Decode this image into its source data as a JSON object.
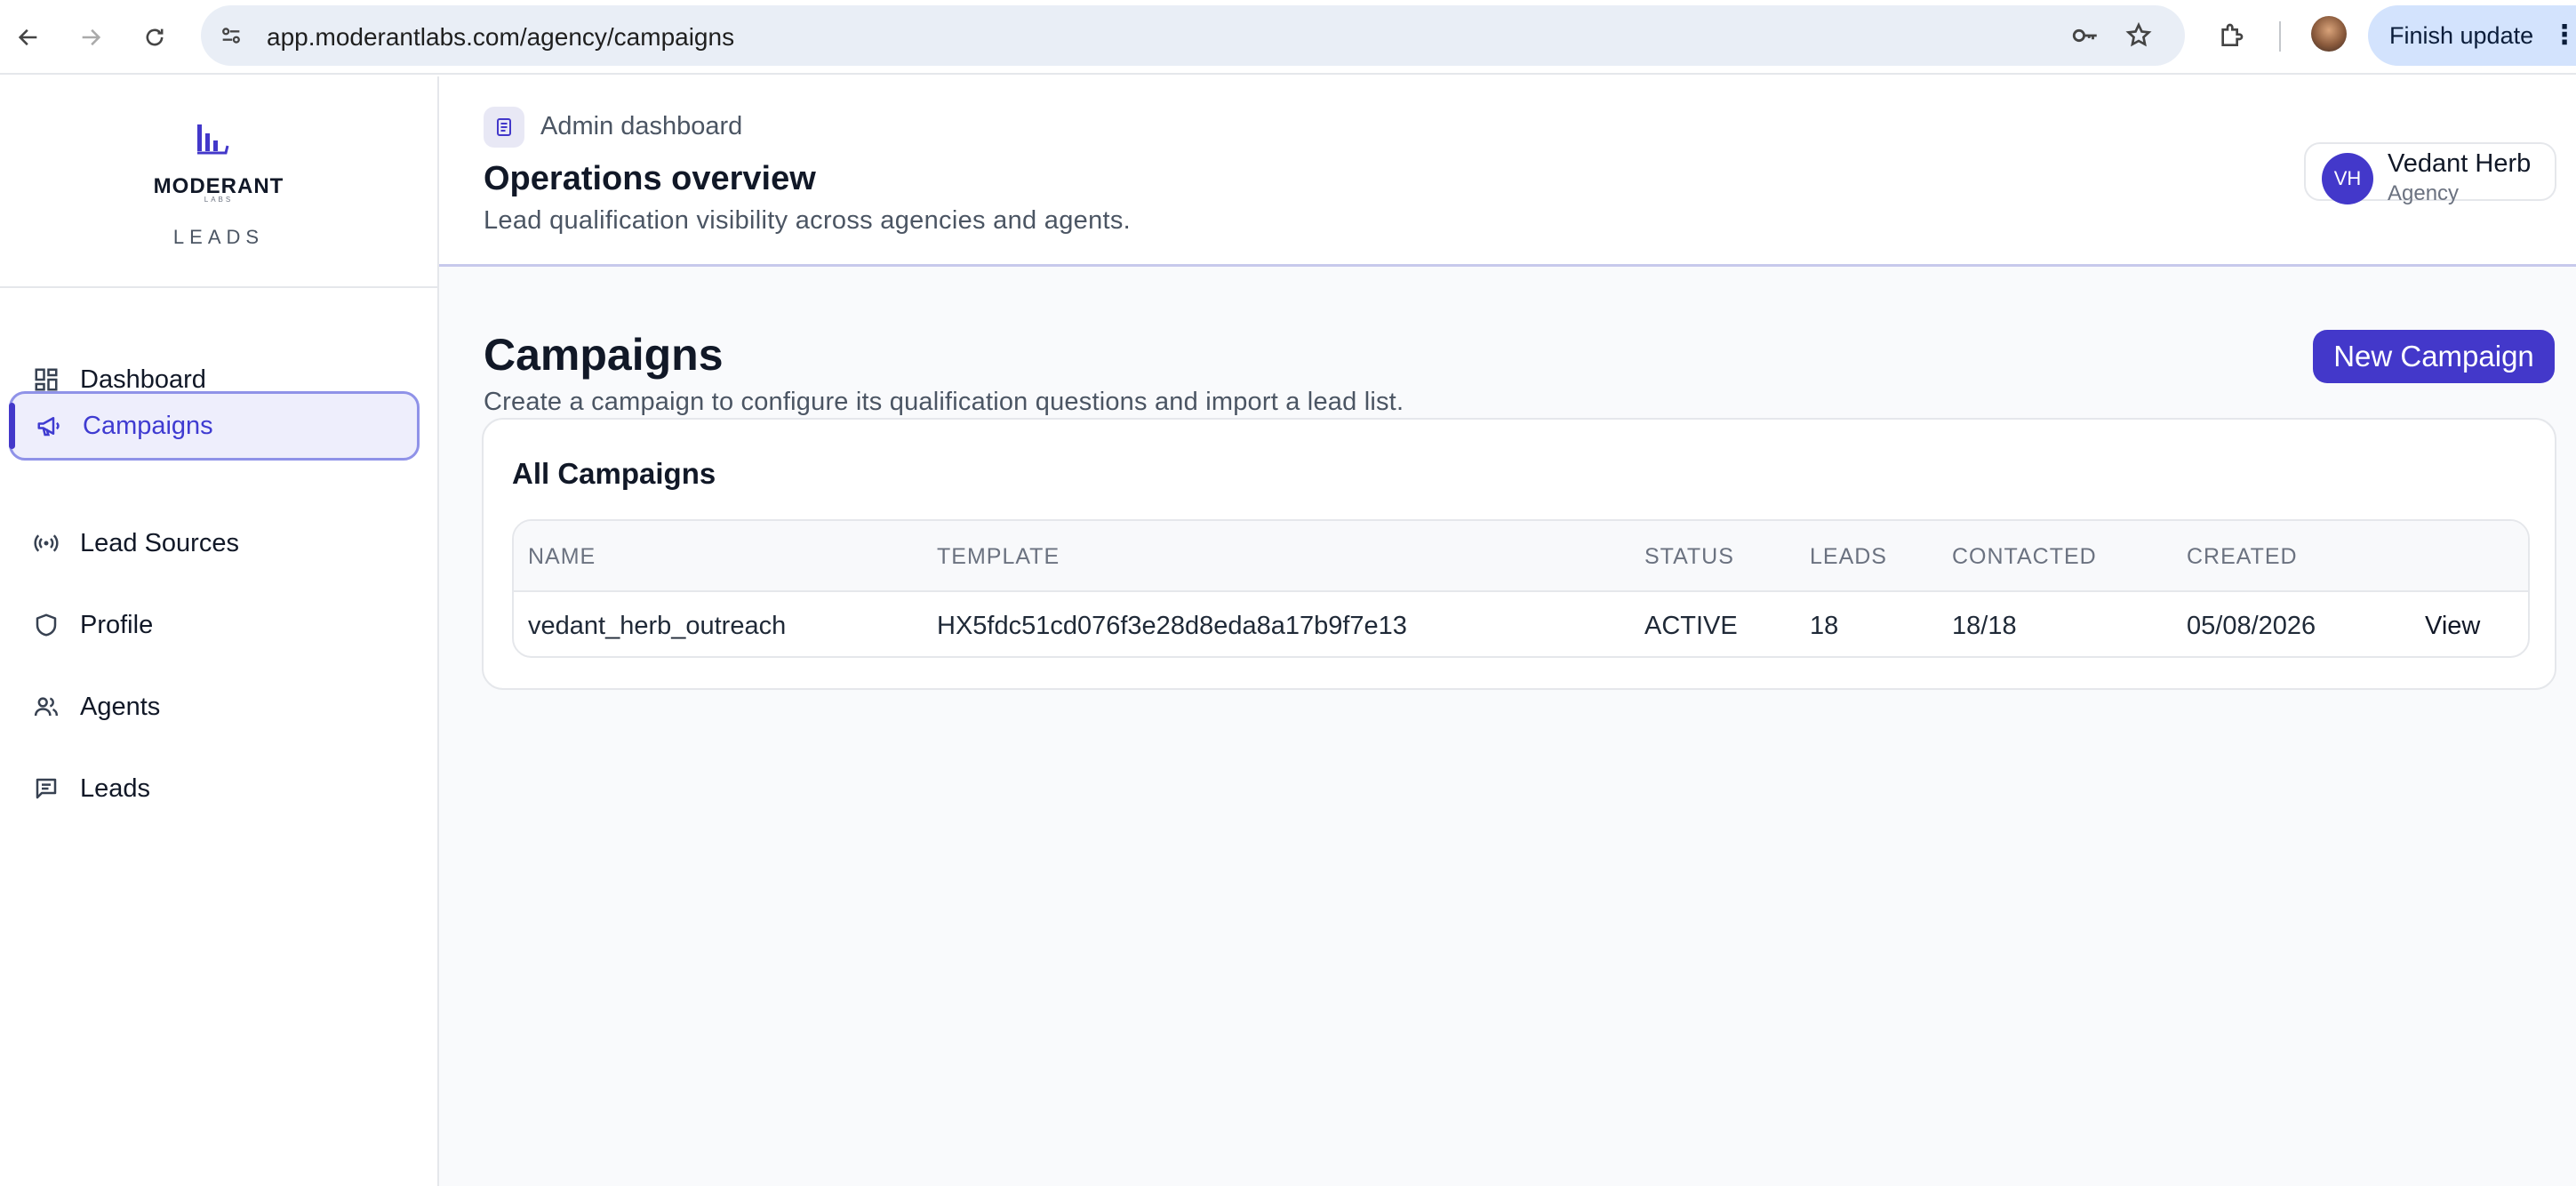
{
  "browser": {
    "url": "app.moderantlabs.com/agency/campaigns",
    "finish_update_label": "Finish update"
  },
  "sidebar": {
    "brand_name": "MODERANT",
    "brand_labs": "LABS",
    "brand_sub": "LEADS",
    "items": [
      {
        "label": "Dashboard",
        "icon": "dashboard-icon"
      },
      {
        "label": "Campaigns",
        "icon": "megaphone-icon",
        "active": true
      },
      {
        "label": "Lead Sources",
        "icon": "broadcast-icon"
      },
      {
        "label": "Profile",
        "icon": "shield-icon"
      },
      {
        "label": "Agents",
        "icon": "users-icon"
      },
      {
        "label": "Leads",
        "icon": "message-icon"
      }
    ]
  },
  "header": {
    "breadcrumb": "Admin dashboard",
    "title": "Operations overview",
    "subtitle": "Lead qualification visibility across agencies and agents.",
    "user": {
      "initials": "VH",
      "name": "Vedant Herb",
      "role": "Agency"
    }
  },
  "page": {
    "title": "Campaigns",
    "subtitle": "Create a campaign to configure its qualification questions and import a lead list.",
    "new_button": "New Campaign"
  },
  "campaigns_card": {
    "title": "All Campaigns",
    "columns": [
      "NAME",
      "TEMPLATE",
      "STATUS",
      "LEADS",
      "CONTACTED",
      "CREATED"
    ],
    "rows": [
      {
        "name": "vedant_herb_outreach",
        "template": "HX5fdc51cd076f3e28d8eda8a17b9f7e13",
        "status": "ACTIVE",
        "leads": "18",
        "contacted": "18/18",
        "created": "05/08/2026",
        "action": "View"
      }
    ]
  },
  "colors": {
    "accent": "#4338ca",
    "active_nav_bg": "#eeeefc",
    "active_nav_border": "#8f92e8"
  }
}
